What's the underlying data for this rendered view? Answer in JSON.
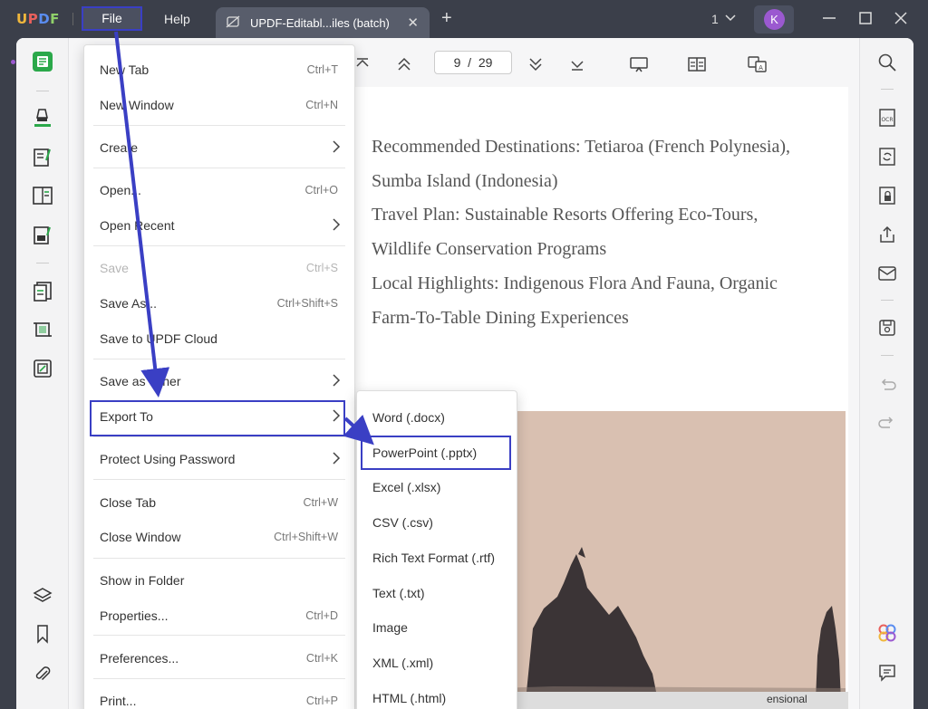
{
  "titlebar": {
    "logo": {
      "u": "U",
      "p": "P",
      "d": "D",
      "f": "F"
    },
    "menu_file": "File",
    "menu_help": "Help",
    "tab_title": "UPDF-Editabl...iles (batch)",
    "tab_close": "✕",
    "tab_add": "+",
    "window_count": "1",
    "avatar_initial": "K"
  },
  "toolbar": {
    "page_current": "9",
    "page_separator": "/",
    "page_total": "29"
  },
  "document": {
    "lines": [
      "Recommended Destinations: Tetiaroa (French Polynesia),",
      "Sumba Island (Indonesia)",
      "Travel Plan: Sustainable Resorts Offering Eco-Tours,",
      "Wildlife Conservation Programs",
      "Local Highlights: Indigenous Flora And Fauna, Organic",
      "Farm-To-Table Dining Experiences"
    ],
    "status_text": "ensional"
  },
  "file_menu": {
    "new_tab": {
      "label": "New Tab",
      "shortcut": "Ctrl+T"
    },
    "new_window": {
      "label": "New Window",
      "shortcut": "Ctrl+N"
    },
    "create": {
      "label": "Create"
    },
    "open": {
      "label": "Open...",
      "shortcut": "Ctrl+O"
    },
    "open_recent": {
      "label": "Open Recent"
    },
    "save": {
      "label": "Save",
      "shortcut": "Ctrl+S"
    },
    "save_as": {
      "label": "Save As...",
      "shortcut": "Ctrl+Shift+S"
    },
    "save_cloud": {
      "label": "Save to UPDF Cloud"
    },
    "save_other": {
      "label": "Save as Other"
    },
    "export_to": {
      "label": "Export To"
    },
    "protect": {
      "label": "Protect Using Password"
    },
    "close_tab": {
      "label": "Close Tab",
      "shortcut": "Ctrl+W"
    },
    "close_window": {
      "label": "Close Window",
      "shortcut": "Ctrl+Shift+W"
    },
    "show_folder": {
      "label": "Show in Folder"
    },
    "properties": {
      "label": "Properties...",
      "shortcut": "Ctrl+D"
    },
    "preferences": {
      "label": "Preferences...",
      "shortcut": "Ctrl+K"
    },
    "print": {
      "label": "Print...",
      "shortcut": "Ctrl+P"
    }
  },
  "export_menu": {
    "items": [
      "Word (.docx)",
      "PowerPoint (.pptx)",
      "Excel (.xlsx)",
      "CSV (.csv)",
      "Rich Text Format (.rtf)",
      "Text (.txt)",
      "Image",
      "XML (.xml)",
      "HTML (.html)"
    ]
  },
  "colors": {
    "highlight_box": "#3a3fc4",
    "annotation_arrow": "#3a3fc4",
    "accent_green": "#2ba84a",
    "avatar": "#9b59d0"
  }
}
